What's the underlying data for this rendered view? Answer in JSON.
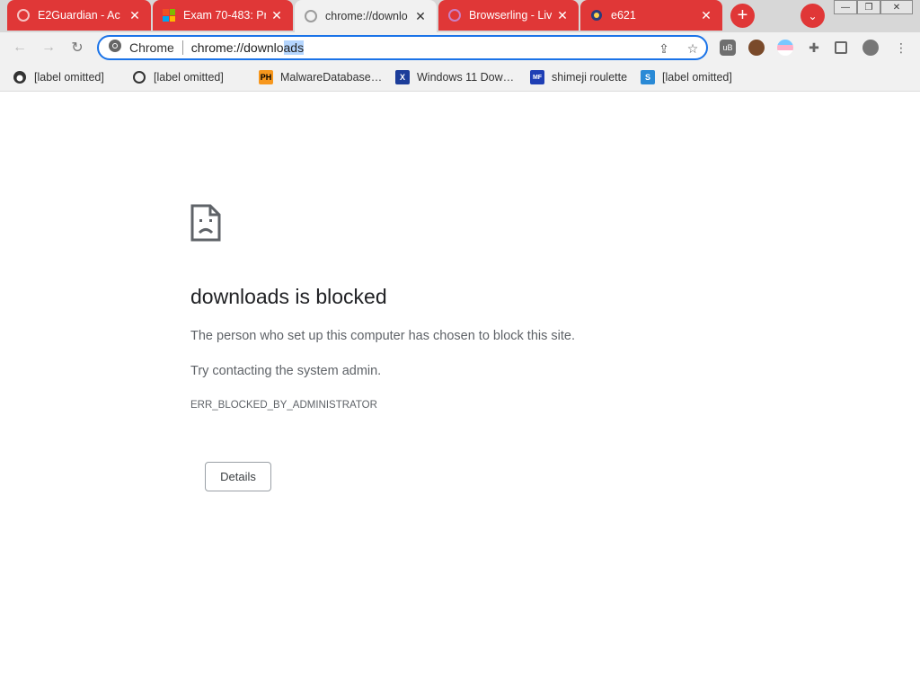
{
  "tabs": [
    {
      "title": "E2Guardian - Ac",
      "icon": "globe-icon",
      "active": false
    },
    {
      "title": "Exam 70-483: Pr",
      "icon": "microsoft-logo-icon",
      "active": false
    },
    {
      "title": "chrome://downlo",
      "icon": "globe-icon",
      "active": true
    },
    {
      "title": "Browserling - Liv",
      "icon": "browserling-icon",
      "active": false
    },
    {
      "title": "e621",
      "icon": "e621-icon",
      "active": false
    }
  ],
  "tab_close_glyph": "✕",
  "new_tab_glyph": "+",
  "tab_search_glyph": "⌄",
  "window": {
    "minimize": "—",
    "restore": "❐",
    "close": "✕"
  },
  "toolbar": {
    "back": "←",
    "forward": "→",
    "reload": "↻"
  },
  "omnibox": {
    "label": "Chrome",
    "url_unselected": "chrome://downlo",
    "url_selected": "ads"
  },
  "omnibox_icons": {
    "share": "⇪",
    "star": "☆"
  },
  "bookmarks": [
    {
      "label": "[label omitted]",
      "icon": "github-icon"
    },
    {
      "label": "[label omitted]",
      "icon": "globe-icon"
    },
    {
      "label": "MalwareDatabase…",
      "icon": "ph-icon",
      "icon_text": "PH"
    },
    {
      "label": "Windows 11 Dow…",
      "icon": "x-icon",
      "icon_text": "X"
    },
    {
      "label": "shimeji roulette",
      "icon": "mf-icon",
      "icon_text": "MF"
    },
    {
      "label": "[label omitted]",
      "icon": "site-icon",
      "icon_text": "S"
    }
  ],
  "page": {
    "title": "downloads is blocked",
    "description": "The person who set up this computer has chosen to block this site.",
    "hint": "Try contacting the system admin.",
    "error_code": "ERR_BLOCKED_BY_ADMINISTRATOR",
    "details_label": "Details"
  },
  "colors": {
    "tab_red": "#e03737",
    "focus_blue": "#1a73e8",
    "selection": "#b4d5fe"
  }
}
